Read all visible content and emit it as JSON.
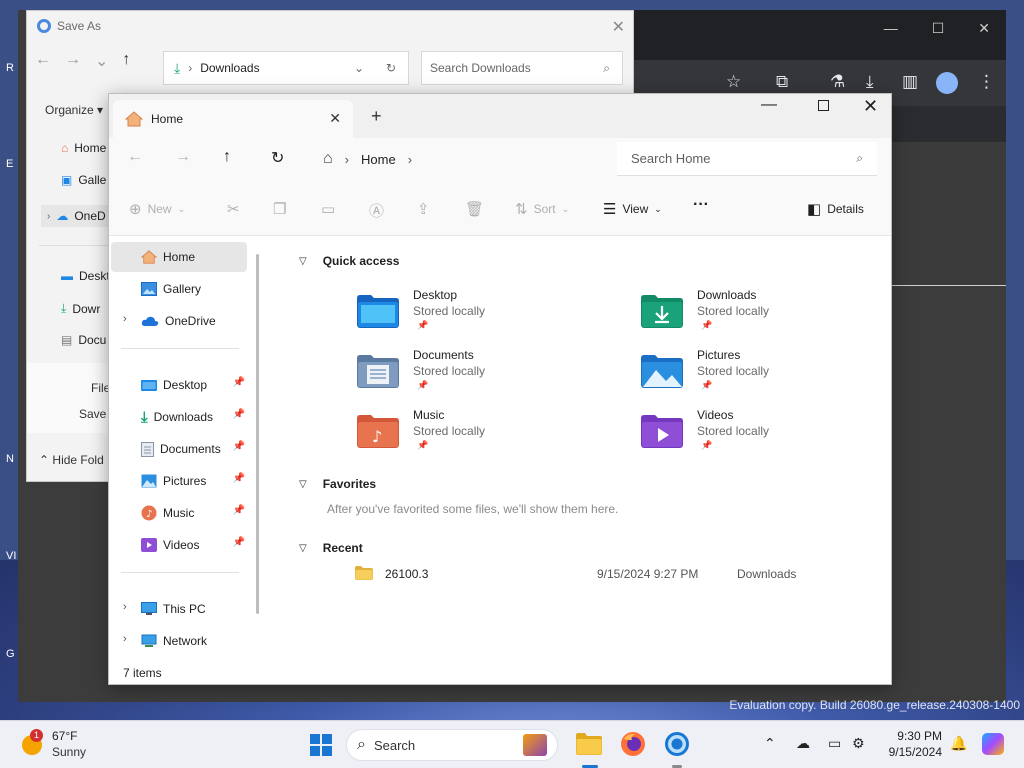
{
  "desktop": {
    "evaluation_text": "Evaluation copy. Build 26080.ge_release.240308-1400",
    "edge_letters": [
      "R",
      "E",
      "N",
      "VI",
      "G"
    ]
  },
  "save_dialog": {
    "title": "Save As",
    "path": "Downloads",
    "search_placeholder": "Search Downloads",
    "organize_label": "Organize",
    "nav_items": [
      "Home",
      "Galle",
      "OneD",
      "Deskt",
      "Dowr",
      "Docu"
    ],
    "file_label": "File",
    "save_label": "Save a",
    "hide_folders_label": "Hide Fold"
  },
  "explorer": {
    "tab_title": "Home",
    "breadcrumb": [
      "Home"
    ],
    "search_placeholder": "Search Home",
    "commands": {
      "new": "New",
      "sort": "Sort",
      "view": "View",
      "details": "Details"
    },
    "nav": {
      "top": [
        {
          "label": "Home",
          "icon": "home-icon"
        },
        {
          "label": "Gallery",
          "icon": "gallery-icon"
        },
        {
          "label": "OneDrive",
          "icon": "onedrive-icon"
        }
      ],
      "pinned": [
        {
          "label": "Desktop",
          "icon": "desktop-folder-icon"
        },
        {
          "label": "Downloads",
          "icon": "downloads-icon"
        },
        {
          "label": "Documents",
          "icon": "documents-icon"
        },
        {
          "label": "Pictures",
          "icon": "pictures-icon"
        },
        {
          "label": "Music",
          "icon": "music-icon"
        },
        {
          "label": "Videos",
          "icon": "videos-icon"
        }
      ],
      "bottom": [
        {
          "label": "This PC",
          "icon": "this-pc-icon"
        },
        {
          "label": "Network",
          "icon": "network-icon"
        }
      ]
    },
    "status": "7 items",
    "quick_access": {
      "header": "Quick access",
      "items": [
        {
          "name": "Desktop",
          "sub": "Stored locally",
          "color": "#1e88e5"
        },
        {
          "name": "Downloads",
          "sub": "Stored locally",
          "color": "#1aa37a"
        },
        {
          "name": "Documents",
          "sub": "Stored locally",
          "color": "#6f8fb5"
        },
        {
          "name": "Pictures",
          "sub": "Stored locally",
          "color": "#2b8fe0"
        },
        {
          "name": "Music",
          "sub": "Stored locally",
          "color": "#e8734f"
        },
        {
          "name": "Videos",
          "sub": "Stored locally",
          "color": "#8e4fd6"
        }
      ]
    },
    "favorites": {
      "header": "Favorites",
      "message": "After you've favorited some files, we'll show them here."
    },
    "recent": {
      "header": "Recent",
      "items": [
        {
          "name": "26100.3",
          "date": "9/15/2024 9:27 PM",
          "location": "Downloads"
        }
      ]
    }
  },
  "taskbar": {
    "weather_temp": "67°F",
    "weather_cond": "Sunny",
    "weather_badge": "1",
    "search_label": "Search",
    "time": "9:30 PM",
    "date": "9/15/2024",
    "accent": "#1976d2"
  }
}
